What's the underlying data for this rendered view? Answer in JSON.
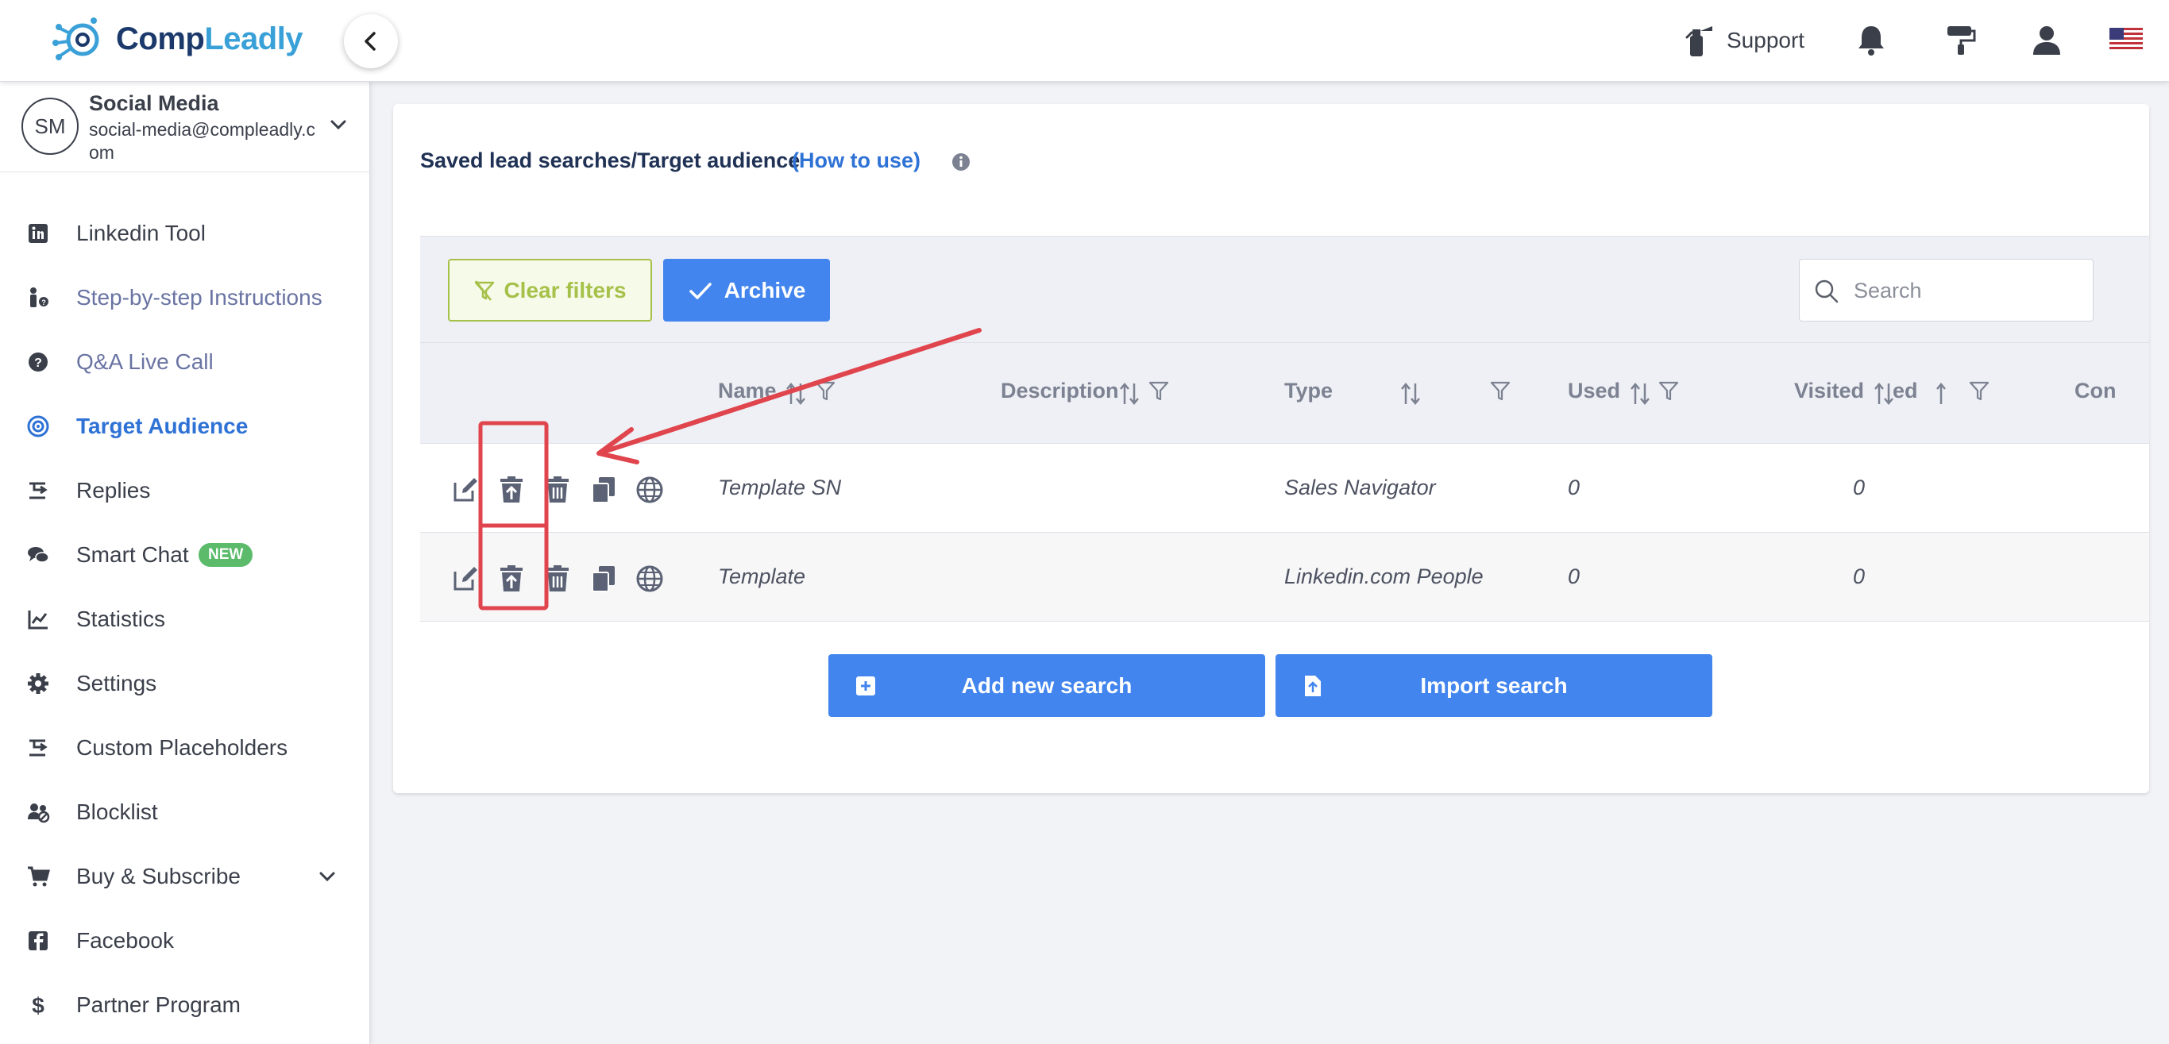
{
  "app": {
    "brand_prefix": "Comp",
    "brand_suffix": "Leadly",
    "collapse_icon": "chevron-left-icon"
  },
  "header": {
    "support_label": "Support",
    "icons": [
      "support-icon",
      "bell-icon",
      "paint-roller-icon",
      "user-icon",
      "us-flag-icon"
    ]
  },
  "account": {
    "initials": "SM",
    "name": "Social Media",
    "email": "social-media@compleadly.com"
  },
  "sidebar": {
    "items": [
      {
        "label": "Linkedin Tool",
        "icon": "linkedin-icon"
      },
      {
        "label": "Step-by-step Instructions",
        "icon": "person-help-icon"
      },
      {
        "label": "Q&A Live Call",
        "icon": "question-circle-icon"
      },
      {
        "label": "Target Audience",
        "icon": "target-icon"
      },
      {
        "label": "Replies",
        "icon": "replies-icon"
      },
      {
        "label": "Smart Chat",
        "icon": "chat-icon",
        "badge": "NEW"
      },
      {
        "label": "Statistics",
        "icon": "chart-line-icon"
      },
      {
        "label": "Settings",
        "icon": "gear-icon"
      },
      {
        "label": "Custom Placeholders",
        "icon": "placeholder-icon"
      },
      {
        "label": "Blocklist",
        "icon": "users-block-icon"
      },
      {
        "label": "Buy & Subscribe",
        "icon": "cart-icon"
      },
      {
        "label": "Facebook",
        "icon": "facebook-icon"
      },
      {
        "label": "Partner Program",
        "icon": "dollar-icon"
      }
    ],
    "active": "Target Audience"
  },
  "main": {
    "title": "Saved lead searches/Target audience",
    "how_to_use": "(How to use)",
    "toolbar": {
      "clear_filters": "Clear filters",
      "archive": "Archive",
      "search_placeholder": "Search"
    },
    "columns": [
      "Name",
      "Description",
      "Type",
      "Used",
      "Visited",
      "ed",
      "Con"
    ],
    "rows": [
      {
        "name": "Template SN",
        "description": "",
        "type": "Sales Navigator",
        "used": "0",
        "visited": "0"
      },
      {
        "name": "Template",
        "description": "",
        "type": "Linkedin.com People",
        "used": "0",
        "visited": "0"
      }
    ],
    "row_action_icons": [
      "edit-icon",
      "unarchive-icon",
      "trash-icon",
      "copy-icon",
      "globe-icon"
    ],
    "add_new_search": "Add new search",
    "import_search": "Import search"
  },
  "colors": {
    "accent_blue": "#4285ee",
    "active_nav": "#2f72d6",
    "clear_filters_green": "#a6c14a",
    "badge_green": "#5bbb6b",
    "annotation_red": "#e0454e"
  }
}
